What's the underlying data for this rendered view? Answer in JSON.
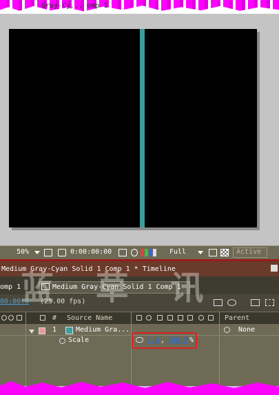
{
  "window": {
    "title_fragment": "Gray-Cy... omp 1"
  },
  "viewer": {
    "zoom": "50%",
    "timecode": "0:00:00:00",
    "resolution": "Full",
    "camera": "Active",
    "solid_color": "#3a9e9a"
  },
  "timeline": {
    "title": "Medium Gray-Cyan Solid 1 Comp 1 * Timeline",
    "tab_left": "omp 1",
    "tab_active": "Medium Gray-Cyan Solid 1 Comp 1",
    "current_time": "00:00:0",
    "fps": "(25.00 fps)",
    "columns": {
      "number": "#",
      "source_name": "Source Name",
      "parent": "Parent"
    },
    "layer": {
      "index": "1",
      "name": "Medium Gra...",
      "parent": "None",
      "property": "Scale",
      "scale_x": "2.0",
      "scale_y": "100.0",
      "separator": ",",
      "unit": "%"
    }
  },
  "watermark": "蓝 草 讯"
}
